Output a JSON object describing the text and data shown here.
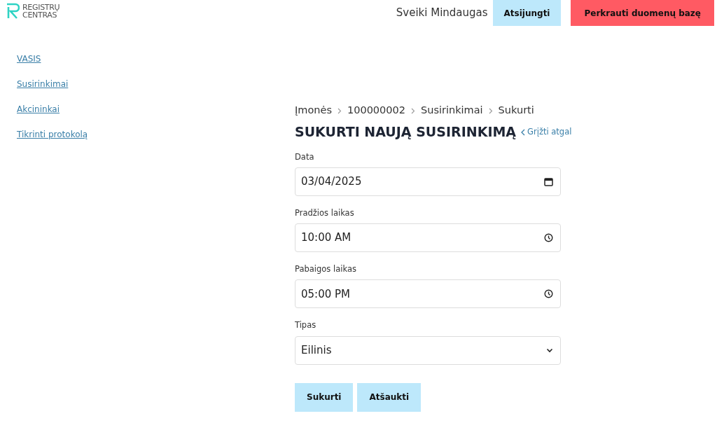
{
  "logo": {
    "line1": "REGISTRŲ",
    "line2": "CENTRAS"
  },
  "header": {
    "greeting": "Sveiki Mindaugas",
    "buttons": [
      {
        "label": "Atsijungti",
        "kind": "light"
      },
      {
        "label": "Perkrauti duomenų bazę",
        "kind": "danger"
      }
    ]
  },
  "sidebar": {
    "items": [
      {
        "label": "VASIS"
      },
      {
        "label": "Susirinkimai"
      },
      {
        "label": "Akcininkai"
      },
      {
        "label": "Tikrinti protokolą"
      }
    ]
  },
  "breadcrumb": [
    "Įmonės",
    "100000002",
    "Susirinkimai",
    "Sukurti"
  ],
  "title": "SUKURTI NAUJĄ SUSIRINKIMĄ",
  "back_link": "Grįžti atgal",
  "fields": [
    {
      "label": "Data",
      "value": "03/04/2025",
      "kind": "date"
    },
    {
      "label": "Pradžios laikas",
      "value": "10:00 AM",
      "kind": "time"
    },
    {
      "label": "Pabaigos laikas",
      "value": "05:00 PM",
      "kind": "time"
    },
    {
      "label": "Tipas",
      "value": "Eilinis",
      "kind": "select"
    }
  ],
  "buttons": [
    "Sukurti",
    "Atšaukti"
  ]
}
